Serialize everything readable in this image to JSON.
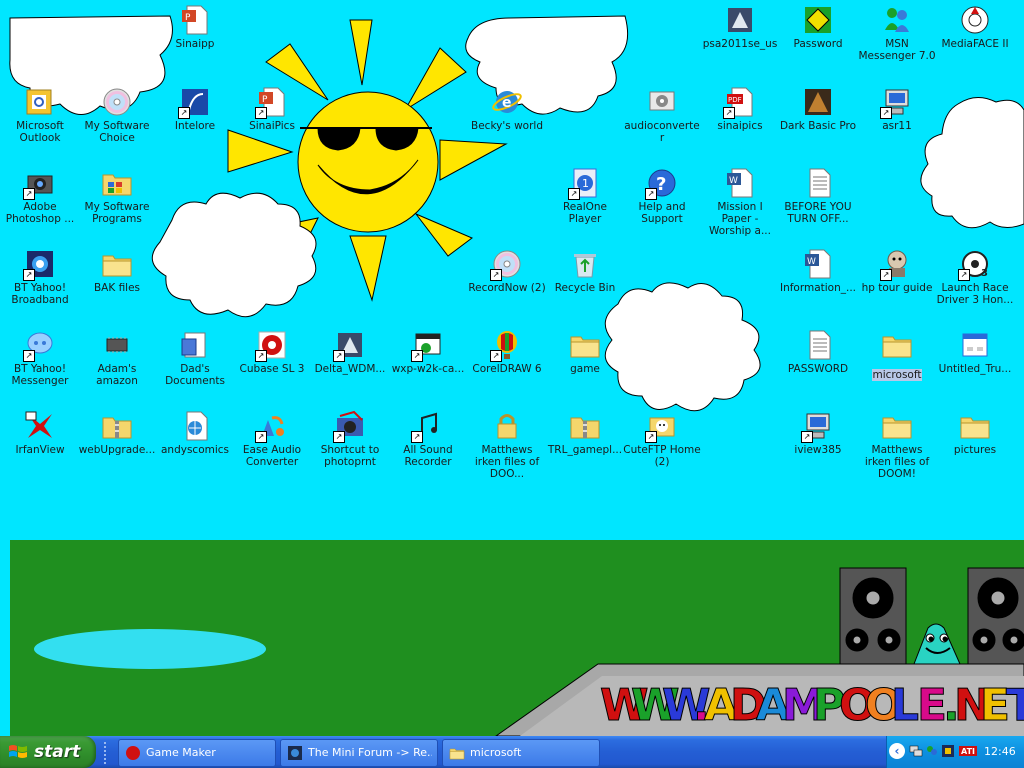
{
  "desktop": {
    "wallpaper_text": "WWW.ADAMPOOLE.NET",
    "icons": [
      {
        "label": "Sinaipp",
        "icon": "powerpoint-file-icon"
      },
      {
        "label": "Microsoft Outlook",
        "icon": "outlook-icon"
      },
      {
        "label": "My Software Choice",
        "icon": "cd-icon"
      },
      {
        "label": "Intelore",
        "icon": "intelore-icon"
      },
      {
        "label": "SinaiPics",
        "icon": "powerpoint-file-icon"
      },
      {
        "label": "Adobe Photoshop ...",
        "icon": "camera-app-icon"
      },
      {
        "label": "My Software Programs",
        "icon": "programs-folder-icon"
      },
      {
        "label": "BT Yahoo! Broadband",
        "icon": "bt-yahoo-icon"
      },
      {
        "label": "BAK files",
        "icon": "folder-icon"
      },
      {
        "label": "BT Yahoo! Messenger",
        "icon": "messenger-icon"
      },
      {
        "label": "Adam's amazon",
        "icon": "chip-icon"
      },
      {
        "label": "Dad's Documents",
        "icon": "documents-icon"
      },
      {
        "label": "Cubase SL 3",
        "icon": "cubase-icon"
      },
      {
        "label": "Delta_WDM...",
        "icon": "installer-icon"
      },
      {
        "label": "wxp-w2k-ca...",
        "icon": "app-window-icon"
      },
      {
        "label": "CorelDRAW 6",
        "icon": "balloon-icon"
      },
      {
        "label": "game",
        "icon": "folder-icon"
      },
      {
        "label": "IrfanView",
        "icon": "irfanview-icon"
      },
      {
        "label": "webUpgrade...",
        "icon": "zip-folder-icon"
      },
      {
        "label": "andyscomics",
        "icon": "web-file-icon"
      },
      {
        "label": "Ease Audio Converter",
        "icon": "audio-converter-icon"
      },
      {
        "label": "Shortcut to photoprnt",
        "icon": "photoprint-icon"
      },
      {
        "label": "All Sound Recorder",
        "icon": "music-icon"
      },
      {
        "label": "Matthews irken files of DOO...",
        "icon": "lock-icon"
      },
      {
        "label": "TRL_gamepl...",
        "icon": "zip-folder-icon"
      },
      {
        "label": "CuteFTP Home (2)",
        "icon": "cuteftp-icon"
      },
      {
        "label": "Becky's world",
        "icon": "internet-explorer-icon"
      },
      {
        "label": "RealOne Player",
        "icon": "realplayer-icon"
      },
      {
        "label": "Help and Support",
        "icon": "help-icon"
      },
      {
        "label": "RecordNow (2)",
        "icon": "cd-icon"
      },
      {
        "label": "Recycle Bin",
        "icon": "recycle-bin-icon"
      },
      {
        "label": "psa2011se_us",
        "icon": "installer-icon"
      },
      {
        "label": "Password",
        "icon": "password-icon"
      },
      {
        "label": "MSN Messenger 7.0",
        "icon": "msn-icon"
      },
      {
        "label": "MediaFACE II",
        "icon": "mediaface-icon"
      },
      {
        "label": "audioconverter",
        "icon": "audioconverter-icon"
      },
      {
        "label": "sinaipics",
        "icon": "pdf-icon"
      },
      {
        "label": "Dark Basic Pro",
        "icon": "darkbasic-icon"
      },
      {
        "label": "asr11",
        "icon": "computer-icon"
      },
      {
        "label": "Mission I Paper - Worship a...",
        "icon": "word-doc-icon"
      },
      {
        "label": "BEFORE YOU TURN OFF...",
        "icon": "text-file-icon"
      },
      {
        "label": "Information_...",
        "icon": "word-doc-icon"
      },
      {
        "label": "hp tour guide",
        "icon": "hp-guide-icon"
      },
      {
        "label": "Launch Race Driver 3 Hon...",
        "icon": "race-driver-icon"
      },
      {
        "label": "PASSWORD",
        "icon": "text-file-icon"
      },
      {
        "label": "microsoft",
        "icon": "folder-icon"
      },
      {
        "label": "Untitled_Tru...",
        "icon": "dialog-icon"
      },
      {
        "label": "iview385",
        "icon": "computer-icon"
      },
      {
        "label": "Matthews irken files of DOOM!",
        "icon": "folder-icon"
      },
      {
        "label": "pictures",
        "icon": "folder-icon"
      }
    ]
  },
  "taskbar": {
    "start_label": "start",
    "tasks": [
      {
        "label": "Game Maker",
        "icon": "game-maker-icon"
      },
      {
        "label": "The Mini Forum -> Re...",
        "icon": "browser-icon"
      },
      {
        "label": "microsoft",
        "icon": "folder-icon"
      }
    ],
    "clock": "12:46"
  },
  "colors": {
    "sky": "#00e6ff",
    "grass": "#1f8f1f",
    "taskbar": "#245ed4",
    "start_button": "#3a9a34",
    "tray": "#0d8fe0"
  }
}
